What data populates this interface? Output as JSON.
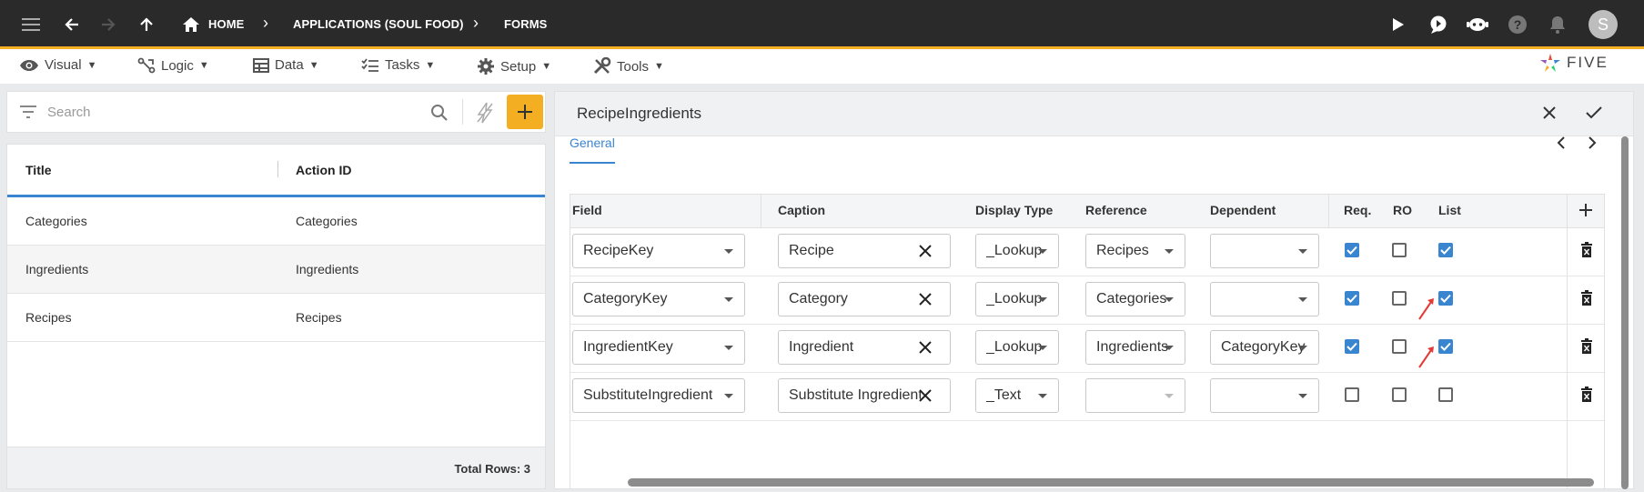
{
  "topbar": {
    "breadcrumbs": [
      "HOME",
      "APPLICATIONS (SOUL FOOD)",
      "FORMS"
    ],
    "avatar_letter": "S",
    "accent_color": "#f4ae22",
    "icons": [
      "hamburger-icon",
      "back-icon",
      "forward-icon",
      "up-icon",
      "home-icon",
      "play-icon",
      "chat-icon",
      "bot-icon",
      "help-icon",
      "bell-icon"
    ]
  },
  "menu": {
    "items": [
      {
        "label": "Visual",
        "icon": "eye-icon"
      },
      {
        "label": "Logic",
        "icon": "logic-icon"
      },
      {
        "label": "Data",
        "icon": "table-icon"
      },
      {
        "label": "Tasks",
        "icon": "tasks-icon"
      },
      {
        "label": "Setup",
        "icon": "gear-icon"
      },
      {
        "label": "Tools",
        "icon": "tools-icon"
      }
    ],
    "logo_text": "FIVE"
  },
  "left": {
    "search_placeholder": "Search",
    "columns": [
      "Title",
      "Action ID"
    ],
    "rows": [
      {
        "title": "Categories",
        "action_id": "Categories"
      },
      {
        "title": "Ingredients",
        "action_id": "Ingredients"
      },
      {
        "title": "Recipes",
        "action_id": "Recipes"
      }
    ],
    "total_rows": "Total Rows: 3"
  },
  "form": {
    "title": "RecipeIngredients",
    "tab": "General",
    "columns": [
      "Field",
      "Caption",
      "Display Type",
      "Reference",
      "Dependent",
      "Req.",
      "RO",
      "List"
    ],
    "rows": [
      {
        "field": "RecipeKey",
        "caption": "Recipe",
        "display_type": "_Lookup",
        "reference": "Recipes",
        "dependent": "",
        "req": true,
        "ro": false,
        "list": true
      },
      {
        "field": "CategoryKey",
        "caption": "Category",
        "display_type": "_Lookup",
        "reference": "Categories",
        "dependent": "",
        "req": true,
        "ro": false,
        "list": true
      },
      {
        "field": "IngredientKey",
        "caption": "Ingredient",
        "display_type": "_Lookup",
        "reference": "Ingredients",
        "dependent": "CategoryKey",
        "req": true,
        "ro": false,
        "list": true
      },
      {
        "field": "SubstituteIngredient",
        "caption": "Substitute Ingredient",
        "display_type": "_Text",
        "reference": "",
        "dependent": "",
        "req": false,
        "ro": false,
        "list": false
      }
    ],
    "checkbox_color": "#3a85d0"
  }
}
